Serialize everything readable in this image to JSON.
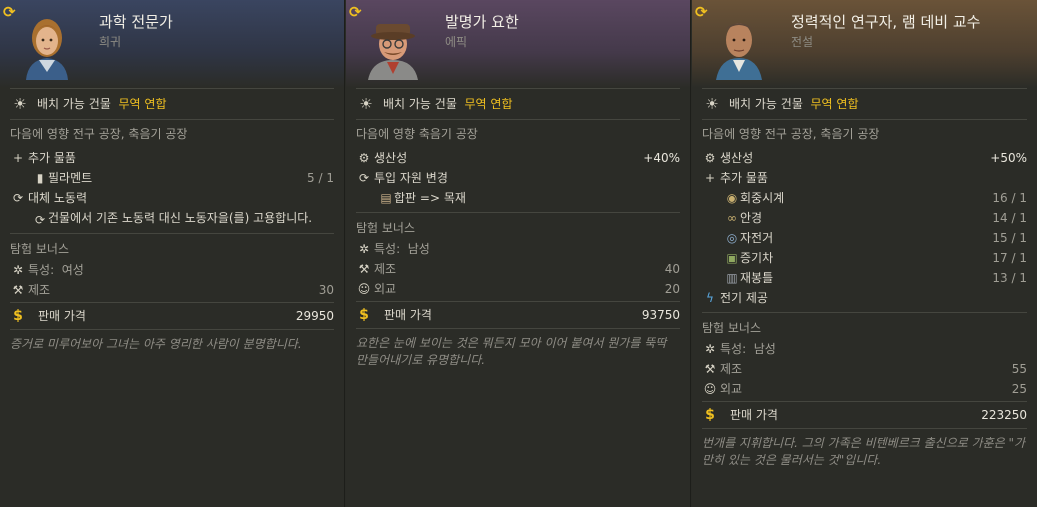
{
  "cards": [
    {
      "title": "과학 전문가",
      "rarity": "희귀",
      "buildable_label": "배치 가능 건물",
      "buildable_value": "무역 연합",
      "affects": "다음에 영향 전구 공장, 축음기 공장",
      "extra_goods_label": "추가 물품",
      "extra_goods": [
        {
          "name": "필라멘트",
          "ratio": "5 / 1"
        }
      ],
      "replace_label": "대체 노동력",
      "replace_desc": "건물에서 기존 노동력 대신 노동자을(를) 고용합니다.",
      "expedition_label": "탐험 보너스",
      "trait_label": "특성:",
      "trait_value": "여성",
      "stats": [
        {
          "name": "제조",
          "value": "30"
        }
      ],
      "price_label": "판매 가격",
      "price": "29950",
      "flavor": "증거로 미루어보아 그녀는 아주 영리한 사람이 분명합니다."
    },
    {
      "title": "발명가 요한",
      "rarity": "에픽",
      "buildable_label": "배치 가능 건물",
      "buildable_value": "무역 연합",
      "affects": "다음에 영향 축음기 공장",
      "productivity_label": "생산성",
      "productivity_value": "+40%",
      "input_change_label": "투입 자원 변경",
      "input_change_value": "합판 => 목재",
      "expedition_label": "탐험 보너스",
      "trait_label": "특성:",
      "trait_value": "남성",
      "stats": [
        {
          "name": "제조",
          "value": "40"
        },
        {
          "name": "외교",
          "value": "20"
        }
      ],
      "price_label": "판매 가격",
      "price": "93750",
      "flavor": "요한은 눈에 보이는 것은 뭐든지 모아 이어 붙여서 뭔가를 뚝딱 만들어내기로 유명합니다."
    },
    {
      "title": "정력적인 연구자, 램 데비 교수",
      "rarity": "전설",
      "buildable_label": "배치 가능 건물",
      "buildable_value": "무역 연합",
      "affects": "다음에 영향 전구 공장, 축음기 공장",
      "productivity_label": "생산성",
      "productivity_value": "+50%",
      "extra_goods_label": "추가 물품",
      "extra_goods": [
        {
          "name": "회중시계",
          "ratio": "16 / 1"
        },
        {
          "name": "안경",
          "ratio": "14 / 1"
        },
        {
          "name": "자전거",
          "ratio": "15 / 1"
        },
        {
          "name": "증기차",
          "ratio": "17 / 1"
        },
        {
          "name": "재봉틀",
          "ratio": "13 / 1"
        }
      ],
      "electricity_label": "전기 제공",
      "expedition_label": "탐험 보너스",
      "trait_label": "특성:",
      "trait_value": "남성",
      "stats": [
        {
          "name": "제조",
          "value": "55"
        },
        {
          "name": "외교",
          "value": "25"
        }
      ],
      "price_label": "판매 가격",
      "price": "223250",
      "flavor": "번개를 지휘합니다. 그의 가족은 비텐베르크 출신으로 가훈은 \"가만히 있는 것은 물러서는 것\"입니다."
    }
  ],
  "icons": {
    "cycle": "cycle-icon",
    "sun": "sun-icon",
    "plus": "plus-icon",
    "gear": "productivity-gear-icon",
    "tools": "tools-icon",
    "diplomacy": "diplomacy-icon",
    "trait": "trait-icon",
    "dollar": "dollar-icon",
    "lightning": "lightning-icon"
  },
  "colors": {
    "accent_gold": "#f0c020",
    "text": "#dcd8cc",
    "dim": "#a3a198"
  }
}
